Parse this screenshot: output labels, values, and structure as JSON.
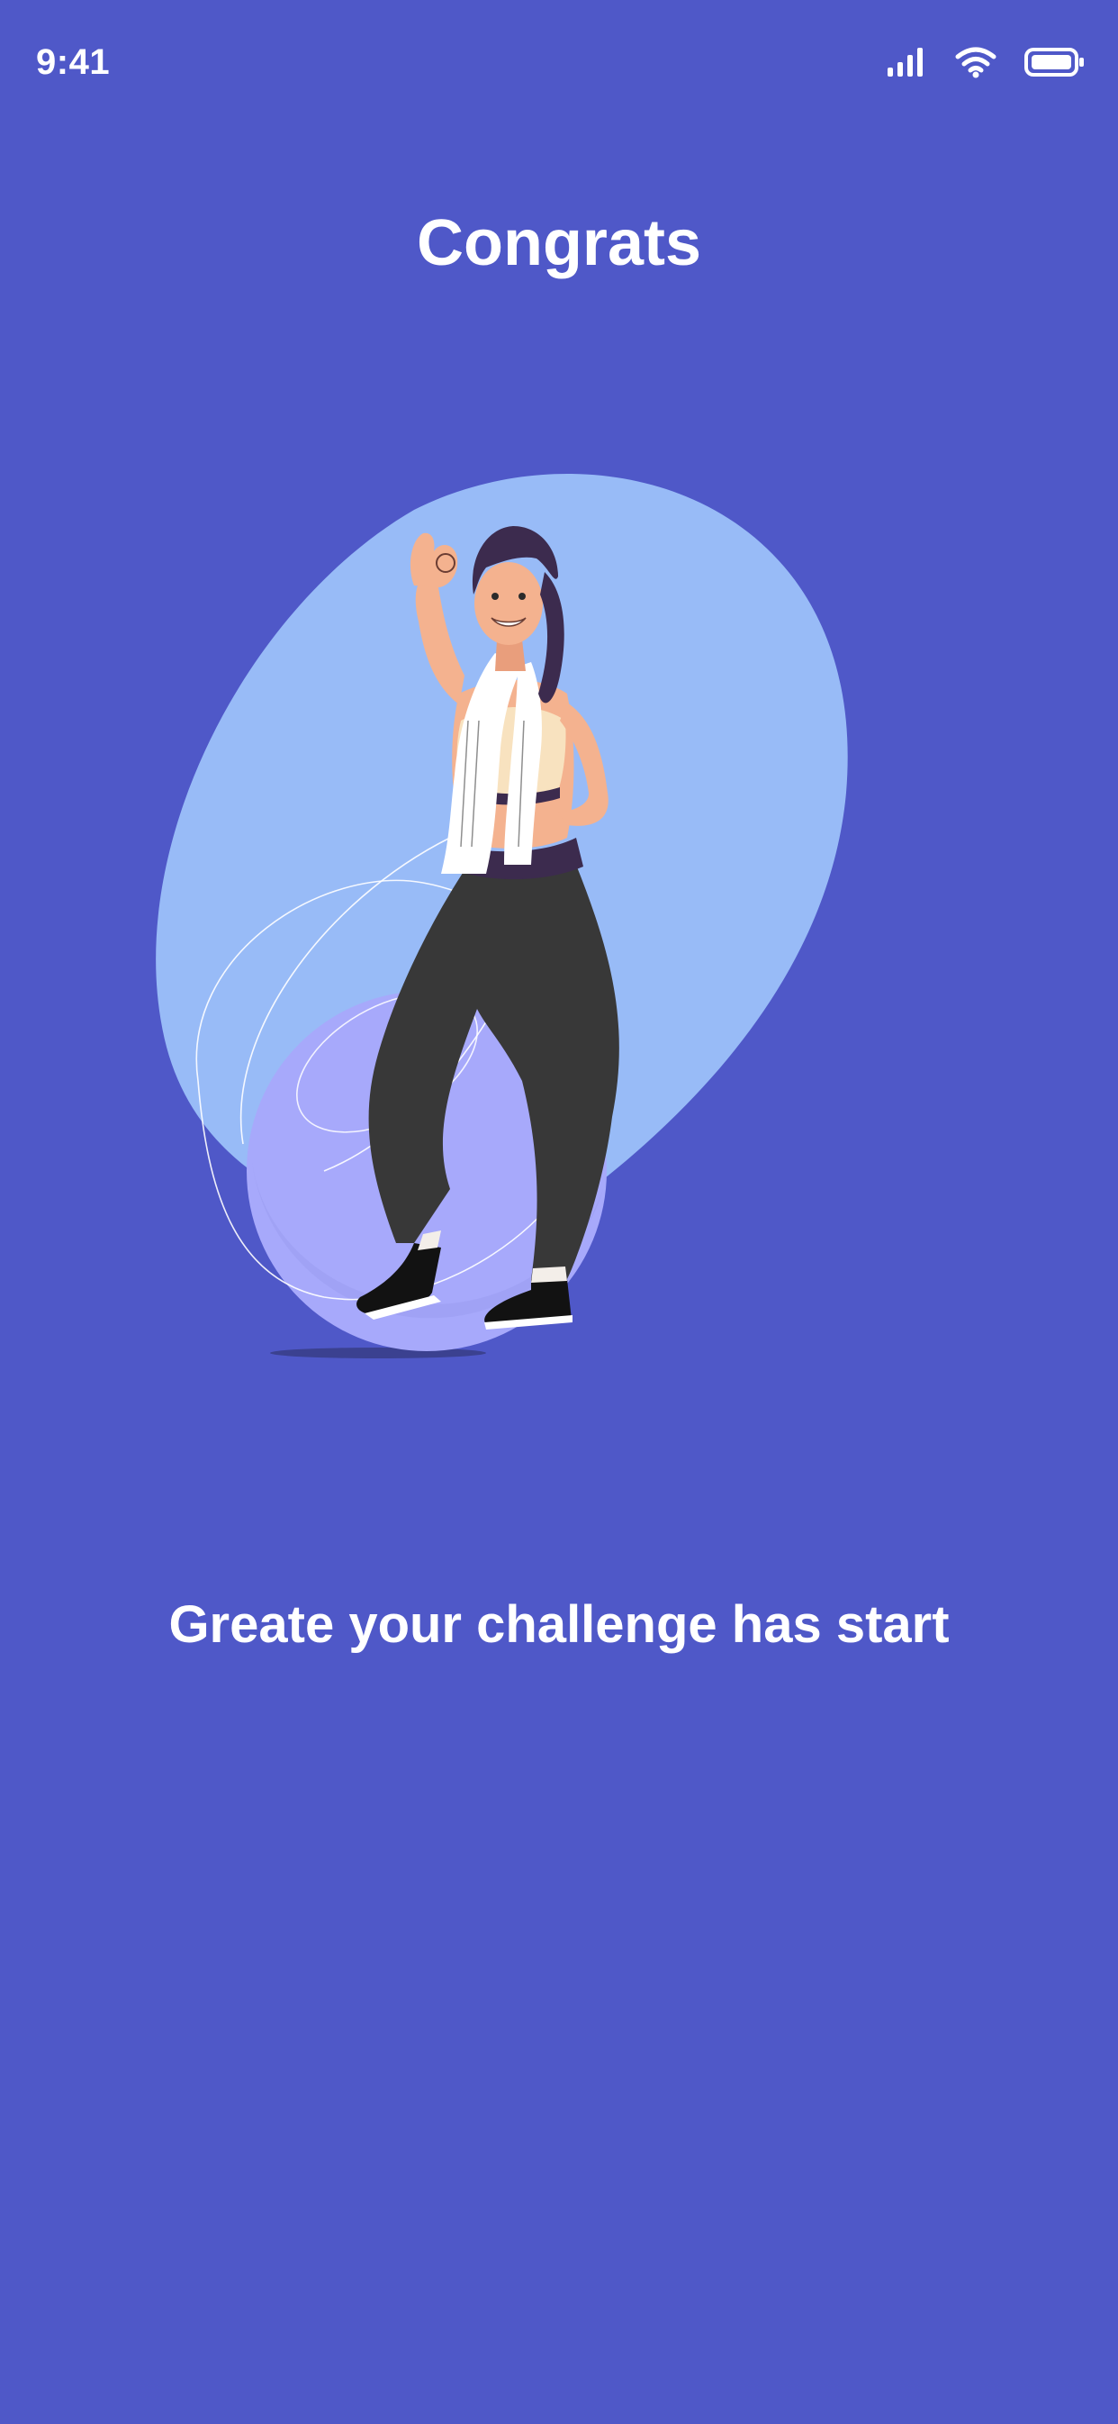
{
  "status_bar": {
    "time": "9:41",
    "icons": [
      "cellular-signal-icon",
      "wifi-icon",
      "battery-icon"
    ]
  },
  "header": {
    "title": "Congrats"
  },
  "illustration": {
    "name": "woman-with-towel-and-fitness-ball-illustration"
  },
  "main": {
    "message": "Greate your challenge has start"
  },
  "colors": {
    "background": "#4f58c8",
    "blob": "#98bbf7",
    "ball": "#a7a9fb",
    "text": "#ffffff"
  }
}
